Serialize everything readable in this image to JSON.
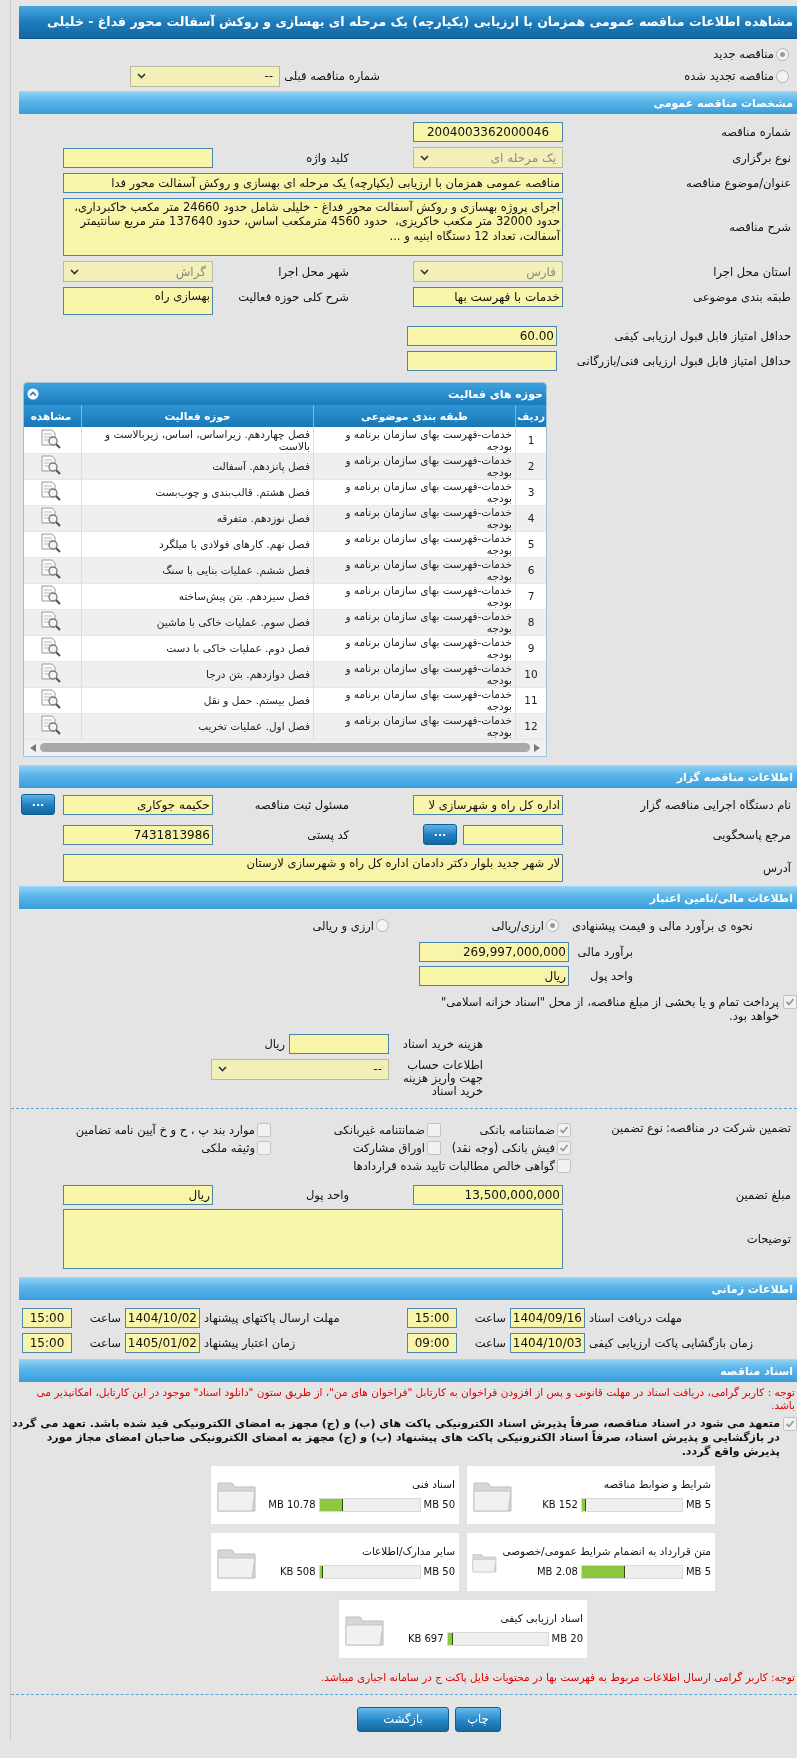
{
  "title": "مشاهده اطلاعات مناقصه عمومی همزمان با ارزیابی (یکپارچه) یک مرحله ای بهسازی و روکش آسفالت محور فداغ - خلیلی",
  "tender_kind": [
    {
      "label": "مناقصه جدید",
      "selected": true
    },
    {
      "label": "مناقصه تجدید شده",
      "selected": false
    }
  ],
  "previous_tender": {
    "label": "شماره مناقصه قبلی",
    "value": "--",
    "disabled": false
  },
  "general": {
    "header": "مشخصات مناقصه عمومی",
    "tender_number": {
      "label": "شماره مناقصه",
      "value": "2004003362000046"
    },
    "holding_type": {
      "label": "نوع برگزاری",
      "value": "یک مرحله ای",
      "disabled": true
    },
    "keyword": {
      "label": "کلید واژه"
    },
    "subject": {
      "label": "عنوان/موضوع مناقصه",
      "value": "مناقصه عمومی همزمان با ارزیابی (یکپارچه) یک مرحله ای بهسازی و روکش آسفالت محور فدا"
    },
    "description": {
      "label": "شرح مناقصه",
      "value": "اجرای پروژه بهسازی و روکش آسفالت محور فداغ - خلیلی شامل حدود 24660 متر مکعب خاکبرداری، حدود 32000 متر مکعب خاکریزی،  حدود 4560 مترمکعب اساس، حدود 137640 متر مربع سانتیمتر آسفالت، تعداد 12 دستگاه ابنیه و ..."
    },
    "province": {
      "label": "استان محل اجرا",
      "value": "فارس",
      "disabled": true
    },
    "city": {
      "label": "شهر محل اجرا",
      "value": "گراش",
      "disabled": true
    },
    "category": {
      "label": "طبقه بندی موضوعی",
      "value": "خدمات با فهرست بها"
    },
    "activity_summary": {
      "label": "شرح کلی حوزه فعالیت",
      "value": "بهسازی راه"
    },
    "min_quality_score": {
      "label": "حداقل امتیاز قابل قبول ارزیابی کیفی",
      "value": "60.00"
    },
    "min_technical_score": {
      "label": "حداقل امتیاز قابل قبول ارزیابی فنی/بازرگانی"
    }
  },
  "activities": {
    "title": "حوزه های فعالیت",
    "columns": [
      "ردیف",
      "طبقه بندی موضوعی",
      "حوزه فعالیت",
      "مشاهده"
    ],
    "rows": [
      {
        "index": "1",
        "category": "خدمات-فهرست بهای سازمان برنامه و بودجه",
        "activity": "فصل چهاردهم. زیراساس، اساس، زیربالاست  و بالاست"
      },
      {
        "index": "2",
        "category": "خدمات-فهرست بهای سازمان برنامه و بودجه",
        "activity": "فصل پانزدهم. آسفالت"
      },
      {
        "index": "3",
        "category": "خدمات-فهرست بهای سازمان برنامه و بودجه",
        "activity": "فصل هشتم. قالب‌بندی و چوب‌بست"
      },
      {
        "index": "4",
        "category": "خدمات-فهرست بهای سازمان برنامه و بودجه",
        "activity": "فصل نوزدهم. متفرقه"
      },
      {
        "index": "5",
        "category": "خدمات-فهرست بهای سازمان برنامه و بودجه",
        "activity": "فصل نهم. کارهای فولادی با میلگرد"
      },
      {
        "index": "6",
        "category": "خدمات-فهرست بهای سازمان برنامه و بودجه",
        "activity": "فصل ششم. عملیات بنایی با سنگ"
      },
      {
        "index": "7",
        "category": "خدمات-فهرست بهای سازمان برنامه و بودجه",
        "activity": "فصل سیزدهم. بتن پیش‌ساخته"
      },
      {
        "index": "8",
        "category": "خدمات-فهرست بهای سازمان برنامه و بودجه",
        "activity": "فصل سوم. عملیات خاکی با ماشین"
      },
      {
        "index": "9",
        "category": "خدمات-فهرست بهای سازمان برنامه و بودجه",
        "activity": "فصل دوم. عملیات خاکی با دست"
      },
      {
        "index": "10",
        "category": "خدمات-فهرست بهای سازمان برنامه و بودجه",
        "activity": "فصل دوازدهم. بتن درجا"
      },
      {
        "index": "11",
        "category": "خدمات-فهرست بهای سازمان برنامه و بودجه",
        "activity": "فصل بیستم. حمل و نقل"
      },
      {
        "index": "12",
        "category": "خدمات-فهرست بهای سازمان برنامه و بودجه",
        "activity": "فصل اول. عملیات تخریب"
      }
    ]
  },
  "organizer": {
    "header": "اطلاعات مناقصه گزار",
    "agency": {
      "label": "نام دستگاه اجرایی مناقصه گزار",
      "value": "اداره کل راه و شهرسازی لا"
    },
    "registrar": {
      "label": "مسئول ثبت مناقصه",
      "value": "حکیمه جوکاری",
      "button": "..."
    },
    "reference": {
      "label": "مرجع پاسخگویی",
      "button": "..."
    },
    "postal_code": {
      "label": "کد پستی",
      "value": "7431813986"
    },
    "address": {
      "label": "آدرس",
      "value": "لار شهر جدید بلوار دکتر دادمان اداره کل راه و شهرسازی لارستان"
    }
  },
  "financial": {
    "header": "اطلاعات مالی/تامین اعتبار",
    "estimate_method": {
      "label": "نحوه ی برآورد مالی و قیمت پیشنهادی",
      "options": [
        {
          "label": "ارزی/ریالی",
          "selected": true
        },
        {
          "label": "ارزی و ریالی",
          "selected": false
        }
      ]
    },
    "budget": {
      "label": "برآورد مالی",
      "value": "269,997,000,000"
    },
    "currency": {
      "label": "واحد پول",
      "value": "ریال"
    },
    "treasury": {
      "label": "پرداخت تمام و یا بخشی از مبلغ مناقصه، از محل \"اسناد خزانه اسلامی\" خواهد بود.",
      "checked": true
    },
    "document_cost": {
      "label": "هزینه خرید اسناد",
      "unit": "ریال"
    },
    "account": {
      "label": "اطلاعات حساب جهت واریز هزینه خرید اسناد",
      "value": "--",
      "disabled": false
    }
  },
  "guarantee": {
    "label": "تضمین شرکت در مناقصه:",
    "type_label": "نوع تضمین",
    "types": [
      {
        "label": "ضمانتنامه بانکی",
        "checked": true
      },
      {
        "label": "ضمانتنامه غیربانکی",
        "checked": false
      },
      {
        "label": "موارد بند پ ، ح و خ آیین نامه تضامین",
        "checked": false
      },
      {
        "label": "فیش بانکی (وجه نقد)",
        "checked": true
      },
      {
        "label": "اوراق مشارکت",
        "checked": false
      },
      {
        "label": "وثیقه ملکی",
        "checked": false
      },
      {
        "label": "گواهی خالص مطالبات تایید شده قراردادها",
        "checked": false
      }
    ],
    "amount": {
      "label": "مبلغ تضمین",
      "value": "13,500,000,000"
    },
    "currency": {
      "label": "واحد پول",
      "value": "ریال"
    },
    "notes": {
      "label": "توضیحات"
    }
  },
  "timing": {
    "header": "اطلاعات زمانی",
    "deadlines": [
      {
        "label": "مهلت دریافت اسناد",
        "date": "1404/09/16",
        "time_label": "ساعت",
        "time": "15:00"
      },
      {
        "label": "مهلت ارسال پاکتهای پیشنهاد",
        "date": "1404/10/02",
        "time_label": "ساعت",
        "time": "15:00"
      },
      {
        "label": "زمان بازگشایی پاکت ارزیابی کیفی",
        "date": "1404/10/03",
        "time_label": "ساعت",
        "time": "09:00"
      },
      {
        "label": "زمان اعتبار پیشنهاد",
        "date": "1405/01/02",
        "time_label": "ساعت",
        "time": "15:00"
      }
    ]
  },
  "documents": {
    "header": "اسناد مناقصه",
    "notice": "توجه : کاربر گرامی، دریافت اسناد در مهلت قانونی و پس از افزودن فراخوان به کارتابل \"فراخوان های من\"، از طریق ستون \"دانلود اسناد\" موجود در این کارتابل، امکانپذیر می باشد.",
    "commitment": {
      "label": "متعهد می شود در اسناد مناقصه، صرفاً پذیرش اسناد الکترونیکی پاکت های (ب) و (ج) مجهز به امضای الکترونیکی قید شده باشد. تعهد می گردد در بازگشایی و پذیرش اسناد، صرفاً اسناد الکترونیکی پاکت های پیشنهاد (ب) و (ج) مجهز به امضای الکترونیکی صاحبان امضای مجاز مورد پذیرش واقع گردد.",
      "checked": true
    },
    "files": [
      {
        "name": "شرایط و ضوابط مناقصه",
        "size": "152 KB",
        "max": "5 MB",
        "level": 0.03
      },
      {
        "name": "اسناد فنی",
        "size": "10.78 MB",
        "max": "50 MB",
        "level": 0.22
      },
      {
        "name": "متن قرارداد به انضمام شرایط عمومی/خصوصی",
        "size": "2.08 MB",
        "max": "5 MB",
        "level": 0.42
      },
      {
        "name": "سایر مدارک/اطلاعات",
        "size": "508 KB",
        "max": "50 MB",
        "level": 0.01
      },
      {
        "name": "اسناد ارزیابی کیفی",
        "size": "697 KB",
        "max": "20 MB",
        "level": 0.04
      }
    ],
    "footnote": "توجه: کاربر گرامی ارسال اطلاعات مربوط به فهرست بها در محتویات فایل پاکت ج در سامانه اجباری میباشد."
  },
  "buttons": [
    "چاپ",
    "بازگشت"
  ]
}
